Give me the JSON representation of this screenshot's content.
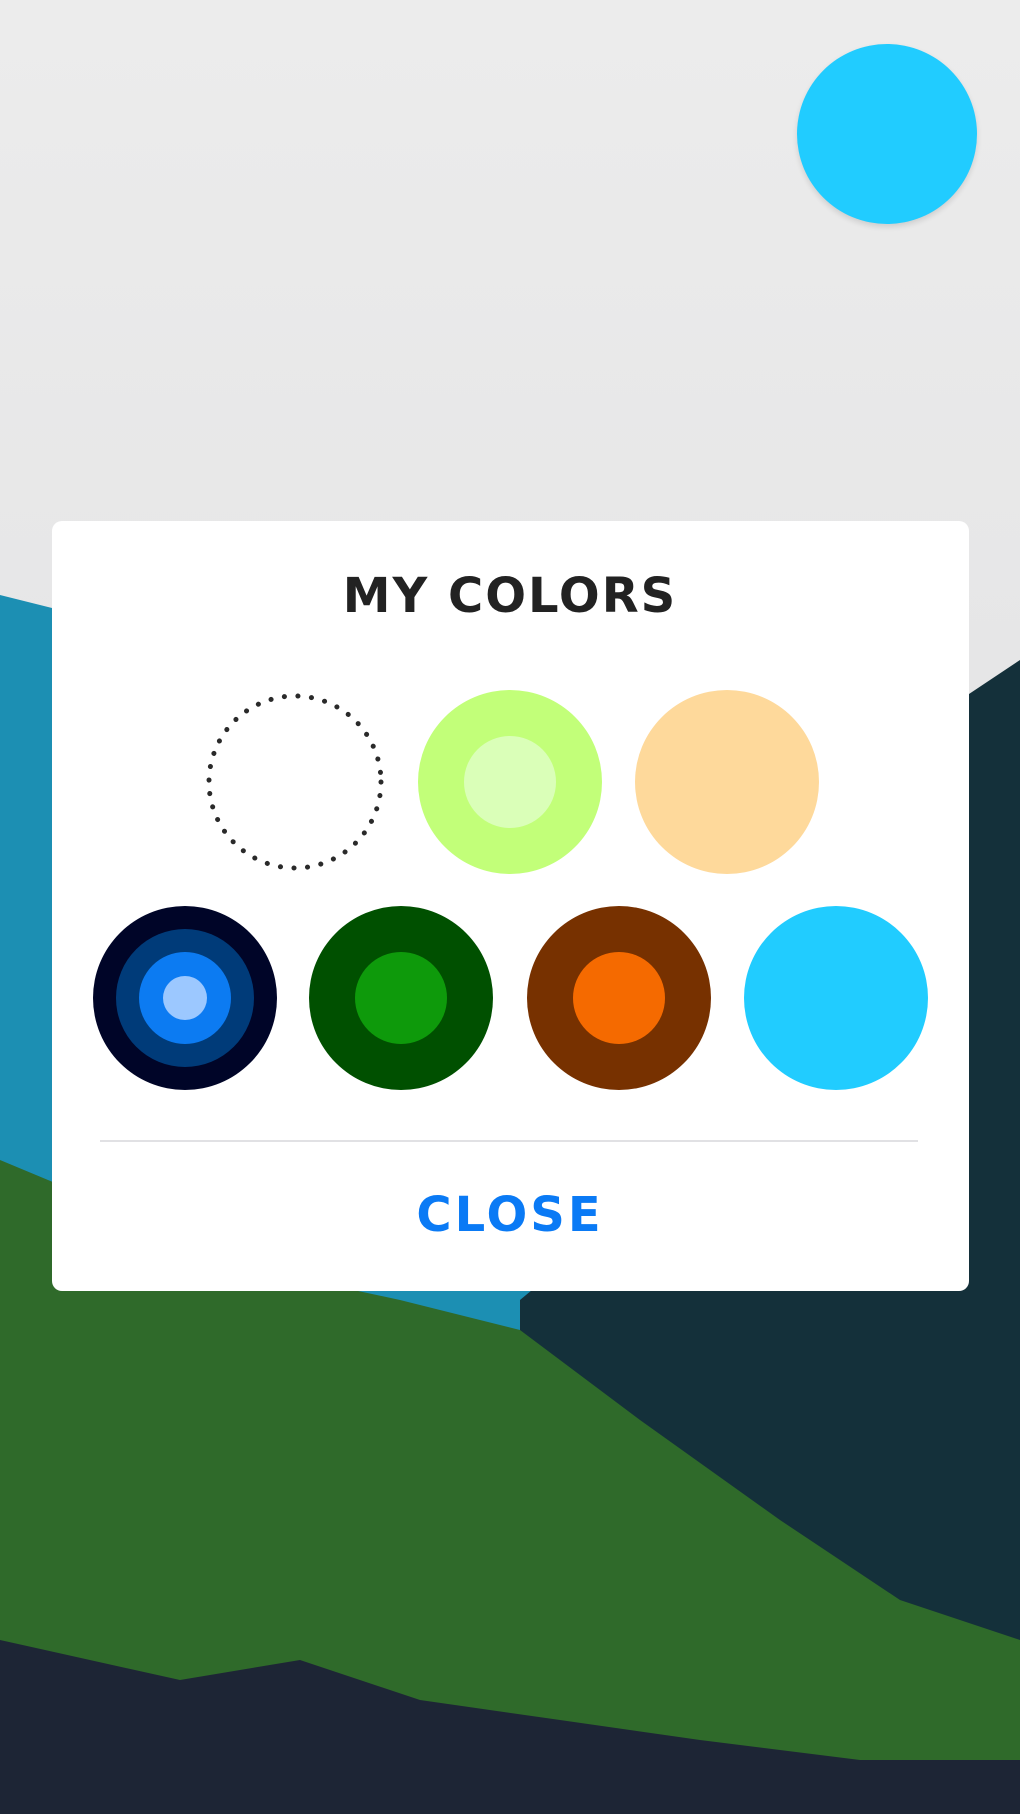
{
  "screen": {
    "background": {
      "sky_top": "#ececec",
      "sky_bottom": "#dcdcde",
      "mountains_blue": "#1c8fb3",
      "mountains_dark": "#14303a",
      "mountains_green": "#2f6a2a",
      "mountains_navy": "#1d2535"
    },
    "current_color": "#21ccff"
  },
  "dialog": {
    "title": "MY COLORS",
    "close_label": "CLOSE",
    "close_color": "#0a7af5",
    "divider_color": "#e1e1e4",
    "swatches": [
      {
        "name": "add-color-slot",
        "type": "empty",
        "rings": []
      },
      {
        "name": "light-green",
        "rings": [
          "#c2ff79",
          "#daffb8"
        ]
      },
      {
        "name": "peach",
        "rings": [
          "#fed99b"
        ]
      },
      {
        "name": "blue",
        "rings": [
          "#000528",
          "#003b79",
          "#0c7bf2",
          "#9cc8ff"
        ]
      },
      {
        "name": "green",
        "rings": [
          "#005000",
          "#0e9a0b"
        ]
      },
      {
        "name": "orange",
        "rings": [
          "#773100",
          "#f56a00"
        ]
      },
      {
        "name": "sky-blue",
        "rings": [
          "#21ccff"
        ]
      }
    ]
  }
}
